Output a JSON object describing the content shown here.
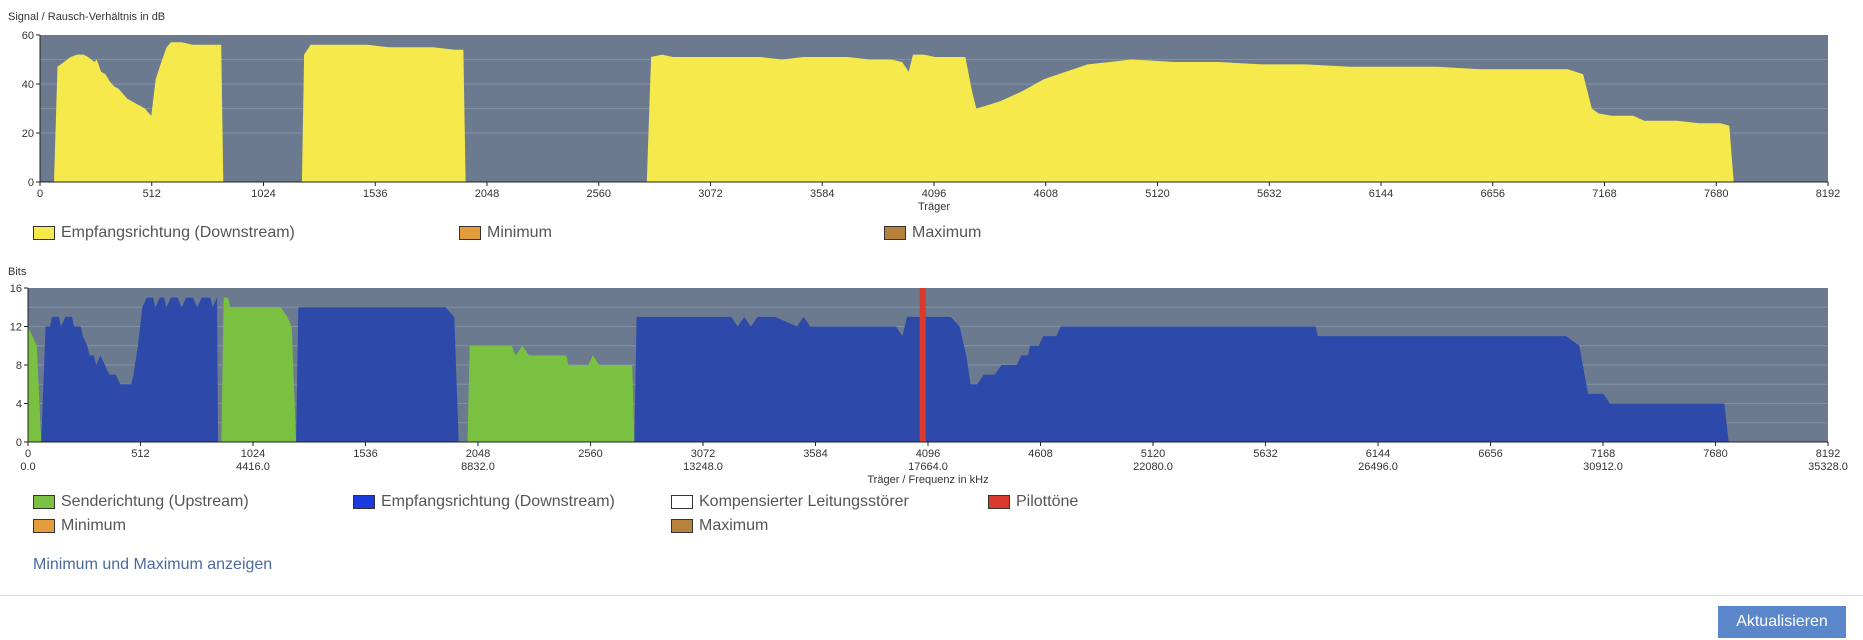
{
  "chart_data": [
    {
      "type": "area",
      "ylabel": "Signal / Rausch-Verhältnis in dB",
      "xlabel": "Träger",
      "xlim": [
        0,
        8192
      ],
      "ylim": [
        0,
        60
      ],
      "x_ticks": [
        0,
        512,
        1024,
        1536,
        2048,
        2560,
        3072,
        3584,
        4096,
        4608,
        5120,
        5632,
        6144,
        6656,
        7168,
        7680,
        8192
      ],
      "y_ticks": [
        0,
        20,
        40,
        60
      ],
      "grid": true,
      "series": [
        {
          "name": "Empfangsrichtung (Downstream)",
          "color": "#f5e94c",
          "points": [
            [
              64,
              0
            ],
            [
              80,
              47
            ],
            [
              110,
              49
            ],
            [
              140,
              51
            ],
            [
              170,
              52
            ],
            [
              200,
              52
            ],
            [
              220,
              51
            ],
            [
              250,
              49
            ],
            [
              260,
              50
            ],
            [
              280,
              45
            ],
            [
              300,
              44
            ],
            [
              320,
              41
            ],
            [
              340,
              39
            ],
            [
              360,
              38
            ],
            [
              380,
              36
            ],
            [
              400,
              34
            ],
            [
              420,
              33
            ],
            [
              440,
              32
            ],
            [
              460,
              31
            ],
            [
              480,
              30
            ],
            [
              500,
              28
            ],
            [
              510,
              27
            ],
            [
              530,
              42
            ],
            [
              560,
              50
            ],
            [
              580,
              55
            ],
            [
              600,
              57
            ],
            [
              650,
              57
            ],
            [
              700,
              56
            ],
            [
              750,
              56
            ],
            [
              800,
              56
            ],
            [
              830,
              56
            ],
            [
              840,
              0
            ],
            [
              1200,
              0
            ],
            [
              1210,
              52
            ],
            [
              1240,
              56
            ],
            [
              1300,
              56
            ],
            [
              1400,
              56
            ],
            [
              1500,
              56
            ],
            [
              1600,
              55
            ],
            [
              1700,
              55
            ],
            [
              1800,
              55
            ],
            [
              1900,
              54
            ],
            [
              1940,
              54
            ],
            [
              1950,
              0
            ],
            [
              2780,
              0
            ],
            [
              2800,
              51
            ],
            [
              2850,
              52
            ],
            [
              2900,
              51
            ],
            [
              3000,
              51
            ],
            [
              3100,
              51
            ],
            [
              3200,
              51
            ],
            [
              3300,
              51
            ],
            [
              3400,
              50
            ],
            [
              3500,
              51
            ],
            [
              3600,
              51
            ],
            [
              3700,
              51
            ],
            [
              3800,
              50
            ],
            [
              3900,
              50
            ],
            [
              3950,
              49
            ],
            [
              3980,
              45
            ],
            [
              4000,
              52
            ],
            [
              4050,
              52
            ],
            [
              4100,
              51
            ],
            [
              4200,
              51
            ],
            [
              4240,
              51
            ],
            [
              4270,
              37
            ],
            [
              4290,
              30
            ],
            [
              4330,
              31
            ],
            [
              4400,
              33
            ],
            [
              4500,
              37
            ],
            [
              4600,
              42
            ],
            [
              4700,
              45
            ],
            [
              4800,
              48
            ],
            [
              4900,
              49
            ],
            [
              5000,
              50
            ],
            [
              5200,
              49
            ],
            [
              5400,
              49
            ],
            [
              5600,
              48
            ],
            [
              5800,
              48
            ],
            [
              6000,
              47
            ],
            [
              6200,
              47
            ],
            [
              6400,
              47
            ],
            [
              6600,
              46
            ],
            [
              6800,
              46
            ],
            [
              7000,
              46
            ],
            [
              7070,
              44
            ],
            [
              7110,
              30
            ],
            [
              7140,
              28
            ],
            [
              7200,
              27
            ],
            [
              7300,
              27
            ],
            [
              7350,
              25
            ],
            [
              7400,
              25
            ],
            [
              7500,
              25
            ],
            [
              7600,
              24
            ],
            [
              7650,
              24
            ],
            [
              7700,
              24
            ],
            [
              7740,
              23
            ],
            [
              7760,
              0
            ]
          ]
        },
        {
          "name": "Minimum",
          "color": "#e39b3c",
          "points": []
        },
        {
          "name": "Maximum",
          "color": "#b8823c",
          "points": []
        }
      ]
    },
    {
      "type": "area",
      "ylabel": "Bits",
      "xlabel": "Träger / Frequenz in kHz",
      "xlim": [
        0,
        8192
      ],
      "ylim": [
        0,
        16
      ],
      "x_ticks": [
        0,
        512,
        1024,
        1536,
        2048,
        2560,
        3072,
        3584,
        4096,
        4608,
        5120,
        5632,
        6144,
        6656,
        7168,
        7680,
        8192
      ],
      "freq_ticks": [
        "0.0",
        "4416.0",
        "8832.0",
        "13248.0",
        "17664.0",
        "22080.0",
        "26496.0",
        "30912.0",
        "35328.0"
      ],
      "y_ticks": [
        "0",
        "4",
        "8",
        "12",
        "16"
      ],
      "grid": true,
      "series": [
        {
          "name": "Sendericht (Upstream)",
          "legend": "Senderichtung (Upstream)",
          "color": "#7ac142",
          "polygons": [
            [
              [
                0,
                0
              ],
              [
                0,
                12
              ],
              [
                20,
                11
              ],
              [
                40,
                10
              ],
              [
                60,
                0
              ]
            ],
            [
              [
                880,
                0
              ],
              [
                890,
                15
              ],
              [
                910,
                15
              ],
              [
                920,
                14
              ],
              [
                1000,
                14
              ],
              [
                1100,
                14
              ],
              [
                1150,
                14
              ],
              [
                1180,
                13
              ],
              [
                1200,
                12
              ],
              [
                1220,
                0
              ]
            ],
            [
              [
                2000,
                0
              ],
              [
                2010,
                10
              ],
              [
                2100,
                10
              ],
              [
                2200,
                10
              ],
              [
                2220,
                9
              ],
              [
                2250,
                10
              ],
              [
                2280,
                9
              ],
              [
                2400,
                9
              ],
              [
                2450,
                9
              ],
              [
                2460,
                8
              ],
              [
                2550,
                8
              ],
              [
                2570,
                9
              ],
              [
                2600,
                8
              ],
              [
                2650,
                8
              ],
              [
                2750,
                8
              ],
              [
                2760,
                0
              ]
            ]
          ]
        },
        {
          "name": "Empfangsrichtung (Downstream)",
          "color": "#2d4aab",
          "polygons": [
            [
              [
                60,
                0
              ],
              [
                80,
                12
              ],
              [
                100,
                12
              ],
              [
                110,
                13
              ],
              [
                140,
                13
              ],
              [
                150,
                12
              ],
              [
                170,
                13
              ],
              [
                200,
                13
              ],
              [
                210,
                12
              ],
              [
                240,
                12
              ],
              [
                250,
                11
              ],
              [
                270,
                10
              ],
              [
                280,
                9
              ],
              [
                300,
                9
              ],
              [
                310,
                8
              ],
              [
                330,
                9
              ],
              [
                350,
                8
              ],
              [
                370,
                7
              ],
              [
                400,
                7
              ],
              [
                420,
                6
              ],
              [
                470,
                6
              ],
              [
                480,
                7
              ],
              [
                500,
                10
              ],
              [
                520,
                14
              ],
              [
                540,
                15
              ],
              [
                570,
                15
              ],
              [
                580,
                14
              ],
              [
                600,
                15
              ],
              [
                620,
                15
              ],
              [
                630,
                14
              ],
              [
                650,
                15
              ],
              [
                680,
                15
              ],
              [
                700,
                14
              ],
              [
                720,
                15
              ],
              [
                750,
                15
              ],
              [
                770,
                14
              ],
              [
                790,
                15
              ],
              [
                830,
                15
              ],
              [
                840,
                14
              ],
              [
                860,
                15
              ],
              [
                865,
                0
              ]
            ],
            [
              [
                1220,
                0
              ],
              [
                1230,
                14
              ],
              [
                1300,
                14
              ],
              [
                1500,
                14
              ],
              [
                1700,
                14
              ],
              [
                1900,
                14
              ],
              [
                1940,
                13
              ],
              [
                1960,
                0
              ]
            ],
            [
              [
                2760,
                0
              ],
              [
                2770,
                13
              ],
              [
                2900,
                13
              ],
              [
                3100,
                13
              ],
              [
                3200,
                13
              ],
              [
                3230,
                12
              ],
              [
                3260,
                13
              ],
              [
                3290,
                12
              ],
              [
                3320,
                13
              ],
              [
                3400,
                13
              ],
              [
                3500,
                12
              ],
              [
                3530,
                13
              ],
              [
                3560,
                12
              ],
              [
                3600,
                12
              ],
              [
                3700,
                12
              ],
              [
                3800,
                12
              ],
              [
                3900,
                12
              ],
              [
                3950,
                12
              ],
              [
                3980,
                11
              ],
              [
                4000,
                13
              ],
              [
                4050,
                13
              ],
              [
                4100,
                13
              ],
              [
                4200,
                13
              ],
              [
                4240,
                12
              ],
              [
                4270,
                9
              ],
              [
                4290,
                6
              ],
              [
                4320,
                6
              ],
              [
                4350,
                7
              ],
              [
                4400,
                7
              ],
              [
                4430,
                8
              ],
              [
                4500,
                8
              ],
              [
                4520,
                9
              ],
              [
                4550,
                9
              ],
              [
                4560,
                10
              ],
              [
                4600,
                10
              ],
              [
                4620,
                11
              ],
              [
                4680,
                11
              ],
              [
                4700,
                12
              ],
              [
                4800,
                12
              ],
              [
                5000,
                12
              ],
              [
                5300,
                12
              ],
              [
                5600,
                12
              ],
              [
                5860,
                12
              ],
              [
                5870,
                11
              ],
              [
                6200,
                11
              ],
              [
                6500,
                11
              ],
              [
                6800,
                11
              ],
              [
                7000,
                11
              ],
              [
                7060,
                10
              ],
              [
                7100,
                5
              ],
              [
                7150,
                5
              ],
              [
                7170,
                5
              ],
              [
                7200,
                4
              ],
              [
                7300,
                4
              ],
              [
                7500,
                4
              ],
              [
                7720,
                4
              ],
              [
                7740,
                0
              ]
            ]
          ]
        },
        {
          "name": "Kompensierter Leitungsstörer",
          "color": "#ffffff",
          "polygons": []
        },
        {
          "name": "Pilottöne",
          "color": "#d93a2b",
          "x": 4072
        },
        {
          "name": "Minimum",
          "color": "#e39b3c",
          "polygons": []
        },
        {
          "name": "Maximum",
          "color": "#b8823c",
          "polygons": []
        }
      ]
    }
  ],
  "controls": {
    "show_minmax_link": "Minimum und Maximum anzeigen",
    "refresh_button": "Aktualisieren"
  }
}
